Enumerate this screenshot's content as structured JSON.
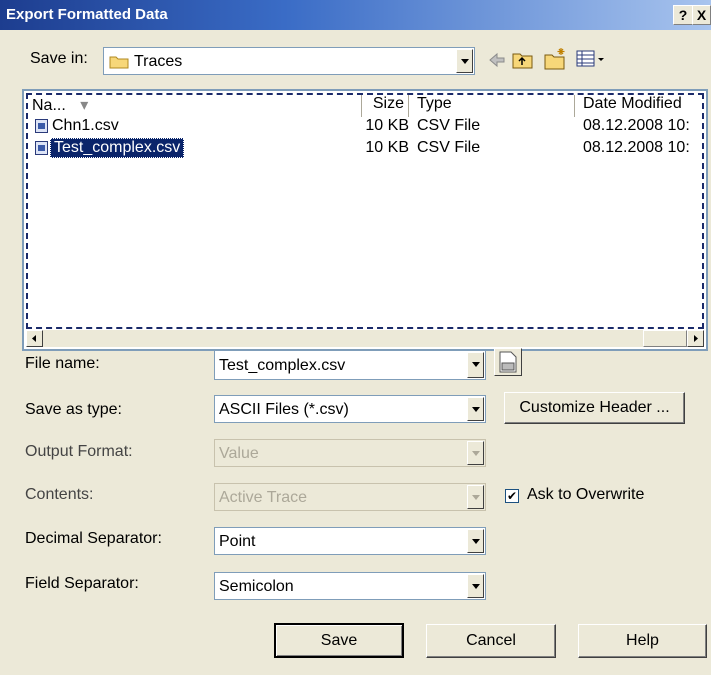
{
  "window": {
    "title": "Export Formatted Data",
    "help_glyph": "?",
    "close_glyph": "X"
  },
  "save_in": {
    "label": "Save in:",
    "value": "Traces"
  },
  "toolbar": {
    "icons": [
      "back-icon",
      "up-folder-icon",
      "new-folder-icon",
      "view-menu-icon"
    ]
  },
  "file_list": {
    "columns": [
      "Na...",
      "Size",
      "Type",
      "Date Modified"
    ],
    "rows": [
      {
        "name": "Chn1.csv",
        "size": "10 KB",
        "type": "CSV File",
        "date": "08.12.2008 10:"
      },
      {
        "name": "Test_complex.csv",
        "size": "10 KB",
        "type": "CSV File",
        "date": "08.12.2008 10:"
      }
    ]
  },
  "form": {
    "file_name": {
      "label": "File name:",
      "value": "Test_complex.csv"
    },
    "save_as_type": {
      "label": "Save as type:",
      "value": "ASCII Files (*.csv)"
    },
    "output_format": {
      "label": "Output Format:",
      "value": "Value"
    },
    "contents": {
      "label": "Contents:",
      "value": "Active Trace"
    },
    "decimal_separator": {
      "label": "Decimal Separator:",
      "value": "Point"
    },
    "field_separator": {
      "label": "Field Separator:",
      "value": "Semicolon"
    }
  },
  "customize_header": "Customize Header ...",
  "ask_overwrite": {
    "label": "Ask to Overwrite",
    "checked": true,
    "check_glyph": "✔"
  },
  "buttons": {
    "save": "Save",
    "cancel": "Cancel",
    "help": "Help"
  }
}
